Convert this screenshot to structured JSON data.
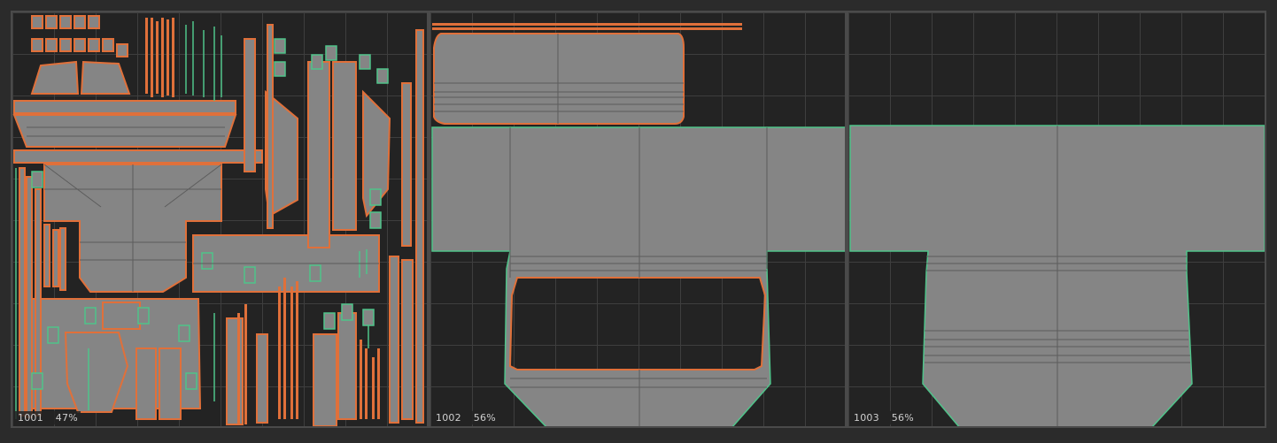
{
  "tiles": [
    {
      "udim": "1001",
      "coverage": "47%"
    },
    {
      "udim": "1002",
      "coverage": "56%"
    },
    {
      "udim": "1003",
      "coverage": "56%"
    }
  ],
  "colors": {
    "background": "#232323",
    "grid": "#3e3e3e",
    "island_fill": "#858585",
    "edge_wire": "#5c5c5c",
    "seam_orange": "#e0703a",
    "border_green": "#4fc48a"
  }
}
